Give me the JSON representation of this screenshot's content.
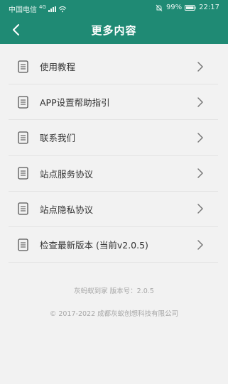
{
  "status_bar": {
    "carrier": "中国电信",
    "network": "4G",
    "battery_percent": "99%",
    "time": "22:17"
  },
  "header": {
    "title": "更多内容",
    "back_icon": "chevron-left-icon",
    "background": "#1f8a74"
  },
  "menu": {
    "items": [
      {
        "label": "使用教程"
      },
      {
        "label": "APP设置帮助指引"
      },
      {
        "label": "联系我们"
      },
      {
        "label": "站点服务协议"
      },
      {
        "label": "站点隐私协议"
      },
      {
        "label": "检查最新版本 (当前v2.0.5)"
      }
    ],
    "item_icon": "document-icon",
    "arrow_icon": "chevron-right-icon"
  },
  "footer": {
    "version_text": "灰蚂蚁到家   版本号：2.0.5",
    "copyright": "© 2017-2022 成都灰蚁创想科技有限公司"
  }
}
